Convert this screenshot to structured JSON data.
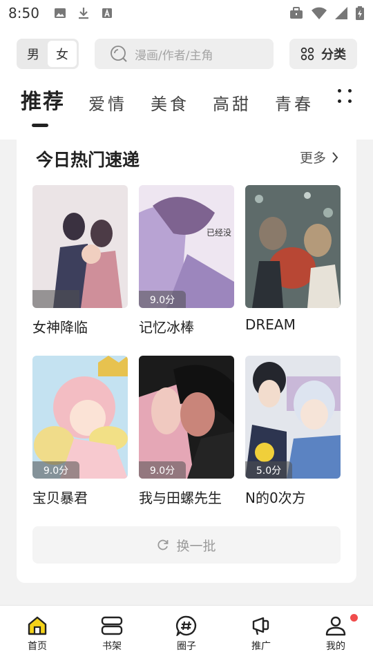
{
  "status_bar": {
    "time": "8:50"
  },
  "gender_switch": {
    "male": "男",
    "female": "女",
    "selected": "女"
  },
  "search": {
    "placeholder": "漫画/作者/主角"
  },
  "category_button": {
    "label": "分类"
  },
  "tabs": [
    "推荐",
    "爱情",
    "美食",
    "高甜",
    "青春"
  ],
  "section": {
    "title": "今日热门速递",
    "more_label": "更多",
    "refresh_label": "换一批",
    "items": [
      {
        "title": "女神降临",
        "score": "",
        "cover_colors": [
          "#e9e2e4",
          "#cdb2c0",
          "#473d4f"
        ]
      },
      {
        "title": "记忆冰棒",
        "score": "9.0分",
        "cover_colors": [
          "#efe7f2",
          "#b59fd0",
          "#7d5f90"
        ]
      },
      {
        "title": "DREAM",
        "score": "",
        "cover_colors": [
          "#5d6a6a",
          "#a54d3c",
          "#2e3338"
        ]
      },
      {
        "title": "宝贝暴君",
        "score": "9.0分",
        "cover_colors": [
          "#bfe0f0",
          "#f3bfc4",
          "#e6c257"
        ]
      },
      {
        "title": "我与田螺先生",
        "score": "9.0分",
        "cover_colors": [
          "#1c1c1c",
          "#e6a6b5",
          "#c77c73"
        ]
      },
      {
        "title": "N的0次方",
        "score": "5.0分",
        "cover_colors": [
          "#dfe4ea",
          "#7ea2d1",
          "#2c2f3a"
        ]
      }
    ]
  },
  "bottom_nav": [
    {
      "label": "首页",
      "icon": "home-icon",
      "active": true
    },
    {
      "label": "书架",
      "icon": "bookshelf-icon"
    },
    {
      "label": "圈子",
      "icon": "hashtag-circle-icon"
    },
    {
      "label": "推广",
      "icon": "megaphone-icon"
    },
    {
      "label": "我的",
      "icon": "profile-icon",
      "badge": true
    }
  ],
  "colors": {
    "accent": "#f5d31a",
    "badge": "#f04c4c"
  }
}
